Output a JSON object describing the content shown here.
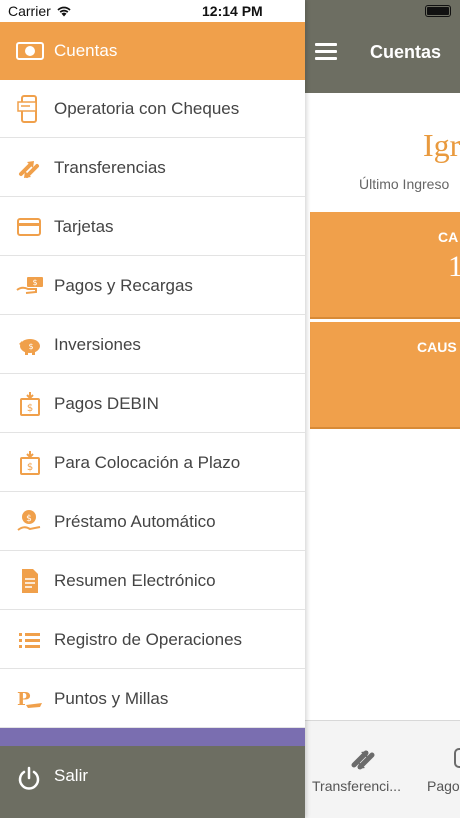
{
  "status_bar": {
    "carrier": "Carrier",
    "time": "12:14 PM"
  },
  "main": {
    "title": "Cuentas",
    "brand_text": "Igr",
    "last_login": "Último Ingreso",
    "cards": [
      {
        "label": "CA",
        "value": "1"
      },
      {
        "label": "CAUS",
        "value": ""
      }
    ],
    "bottom_tabs": [
      {
        "label": "Transferenci...",
        "icon": "transfer-icon"
      },
      {
        "label": "Pago",
        "icon": "payments-icon"
      }
    ]
  },
  "drawer": {
    "items": [
      {
        "label": "Cuentas",
        "icon": "cash-icon",
        "active": true
      },
      {
        "label": "Operatoria con Cheques",
        "icon": "check-phone-icon"
      },
      {
        "label": "Transferencias",
        "icon": "transfer-icon"
      },
      {
        "label": "Tarjetas",
        "icon": "card-icon"
      },
      {
        "label": "Pagos y Recargas",
        "icon": "payment-hand-icon"
      },
      {
        "label": "Inversiones",
        "icon": "piggy-bank-icon"
      },
      {
        "label": "Pagos DEBIN",
        "icon": "debin-icon"
      },
      {
        "label": "Para Colocación a Plazo",
        "icon": "term-deposit-icon"
      },
      {
        "label": "Préstamo Automático",
        "icon": "loan-icon"
      },
      {
        "label": "Resumen Electrónico",
        "icon": "document-icon"
      },
      {
        "label": "Registro de Operaciones",
        "icon": "list-icon"
      },
      {
        "label": "Puntos y Millas",
        "icon": "points-icon"
      }
    ],
    "logout_label": "Salir"
  },
  "colors": {
    "accent": "#f0a04b",
    "header": "#6d6e62",
    "strip": "#7a6eb0"
  }
}
